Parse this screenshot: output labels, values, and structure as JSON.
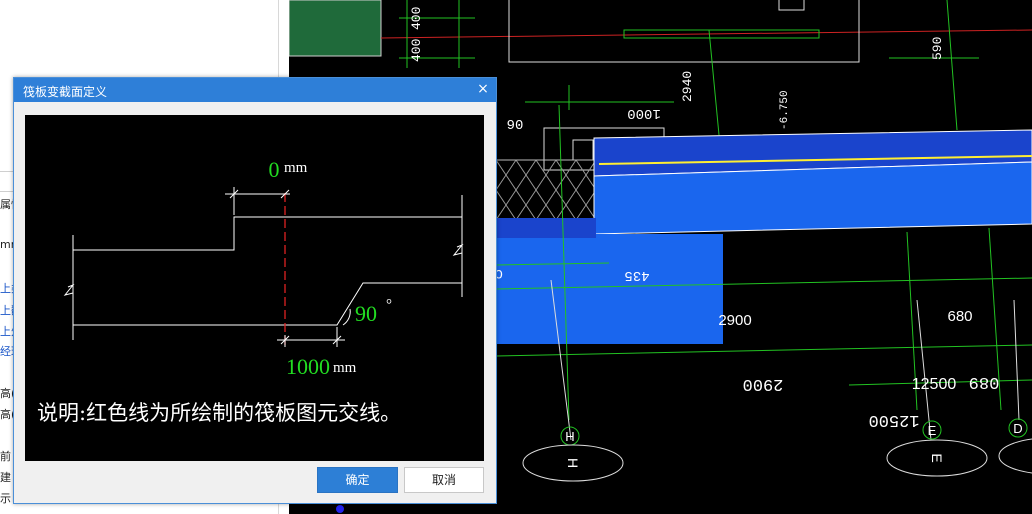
{
  "left_panel": {
    "fragments": [
      "属性",
      "mm",
      "上类",
      "上翻",
      "上外",
      "经理",
      "高(m",
      "高(m",
      "前",
      "建",
      "示"
    ]
  },
  "cad": {
    "dims": {
      "d400a": "400",
      "d400b": "400",
      "d590": "590",
      "d2940": "2940",
      "d1000": "1000",
      "d06": "06",
      "d435": "435",
      "dC": "C",
      "d2900": "2900",
      "d680": "680",
      "d2900m": "2900",
      "d12500": "12500",
      "d12500m": "12500",
      "d089": "089",
      "tag": "-6.750"
    },
    "axes": {
      "H": "H",
      "E": "E",
      "D": "D"
    }
  },
  "dialog": {
    "title": "筏板变截面定义",
    "close_glyph": "×",
    "preview": {
      "top_offset_value": "0",
      "top_offset_unit": "mm",
      "angle_value": "90",
      "angle_unit": "°",
      "bottom_offset_value": "1000",
      "bottom_offset_unit": "mm",
      "note": "说明:红色线为所绘制的筏板图元交线。"
    },
    "ok_label": "确定",
    "cancel_label": "取消"
  },
  "colors": {
    "dialog_title_bg": "#2e7fd8",
    "ok_button": "#2d7fd6",
    "green_value": "#22dd22",
    "intersection_line": "#dd2222",
    "slab_blue": "#1a66ee",
    "grid_green": "#22c222"
  }
}
